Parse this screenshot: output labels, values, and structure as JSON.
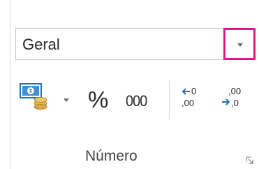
{
  "number_group": {
    "format_value": "Geral",
    "group_label": "Número",
    "percent_label": "%",
    "comma_label": "000"
  },
  "decimal_buttons": {
    "increase_top": "0",
    "increase_bottom": ",00",
    "decrease_top": ",00",
    "decrease_bottom": ",0"
  },
  "colors": {
    "highlight": "#e0168e",
    "icon_blue": "#1f73b7",
    "icon_gold": "#d7a84b"
  },
  "icons": [
    "accounting-format-icon",
    "percent-icon",
    "comma-style-icon",
    "increase-decimal-icon",
    "decrease-decimal-icon",
    "dialog-launcher-icon",
    "dropdown-arrow-icon"
  ]
}
